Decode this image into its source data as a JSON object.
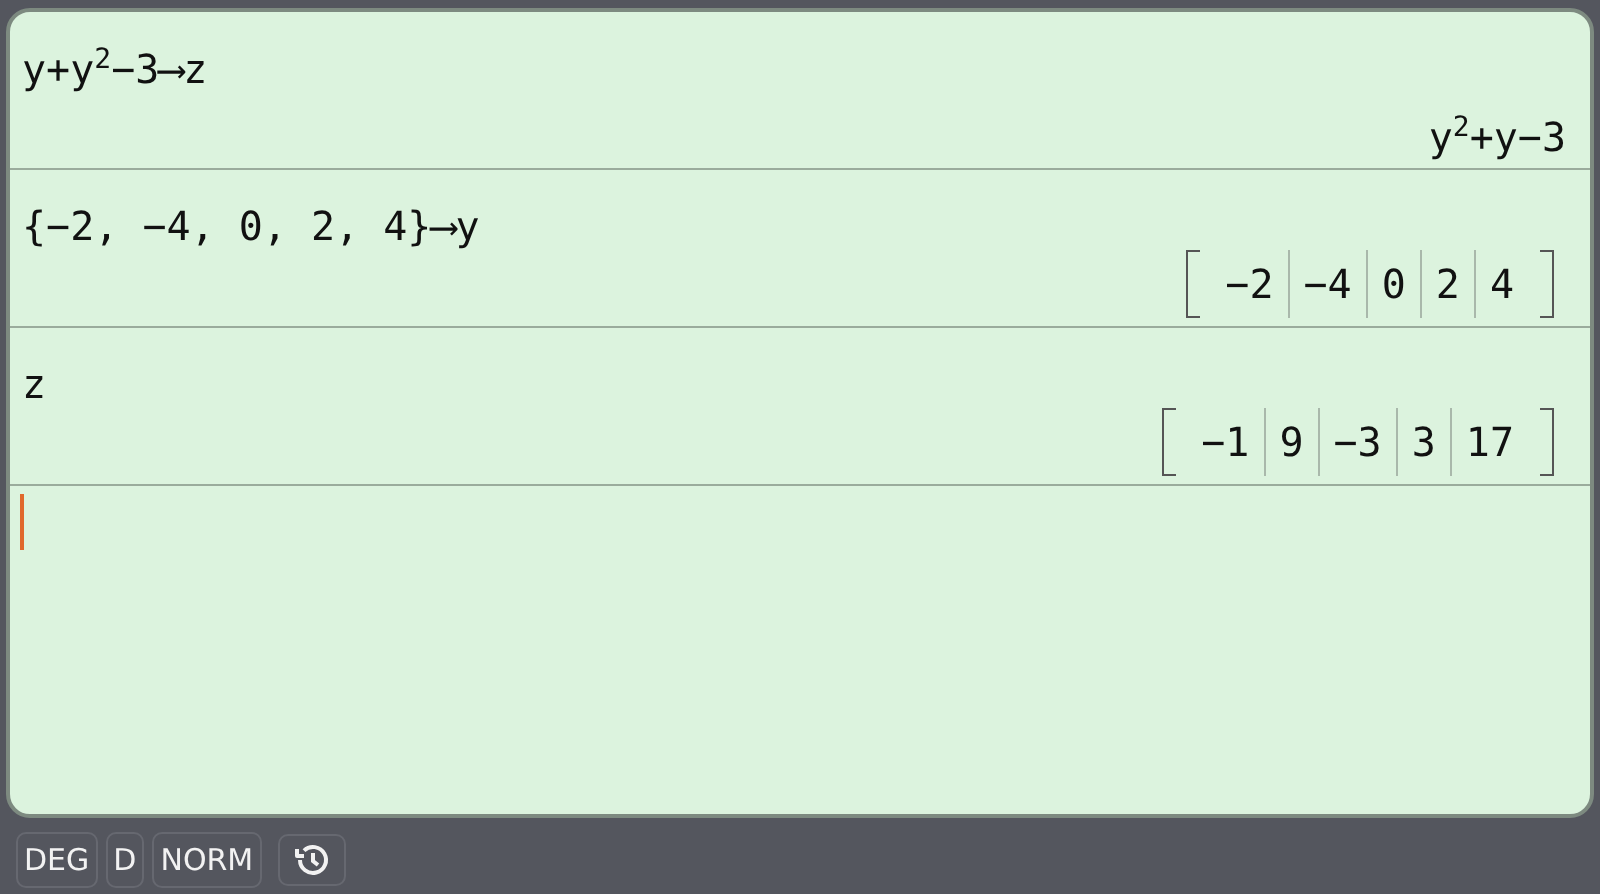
{
  "history": [
    {
      "input": "y+y$^{2}$−3⟶z",
      "result": {
        "kind": "expression",
        "text": "y$^{2}$+y−3"
      }
    },
    {
      "input": "{−2, −4, 0, 2, 4}⟶y",
      "result": {
        "kind": "vector",
        "elements": [
          "−2",
          "−4",
          "0",
          "2",
          "4"
        ]
      }
    },
    {
      "input": "z",
      "result": {
        "kind": "vector",
        "elements": [
          "−1",
          "9",
          "−3",
          "3",
          "17"
        ]
      }
    }
  ],
  "status_bar": {
    "buttons": [
      "DEG",
      "D",
      "NORM"
    ]
  }
}
